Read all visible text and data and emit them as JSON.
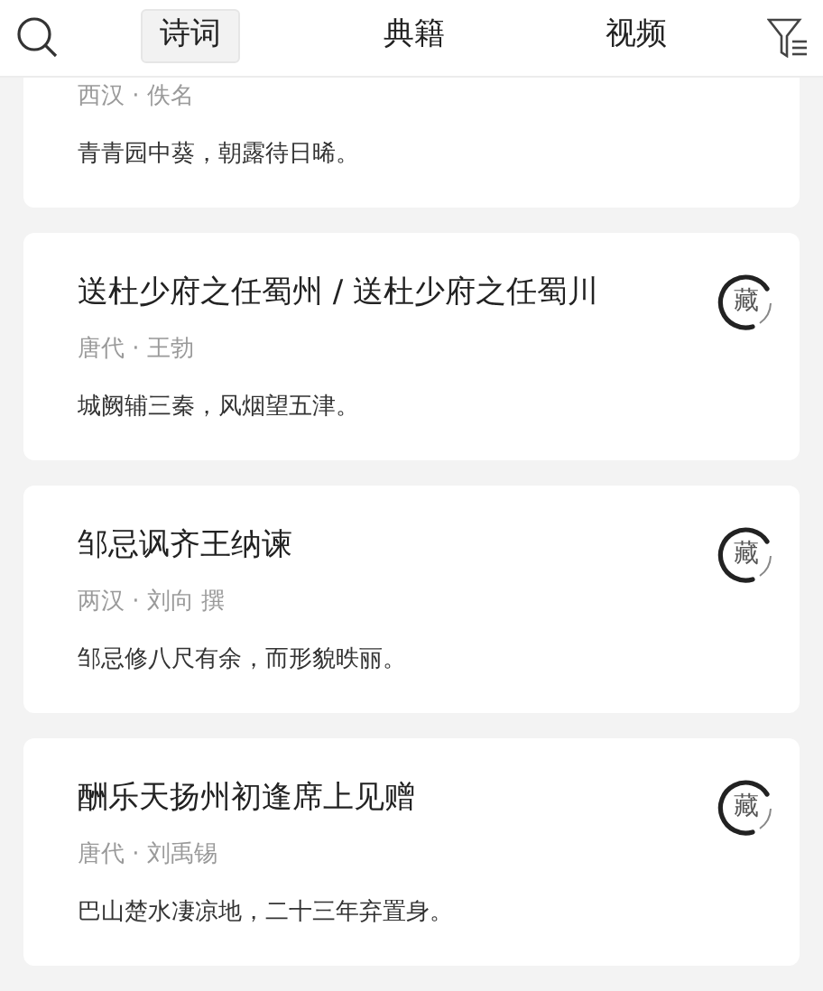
{
  "tabs": [
    {
      "label": "诗词",
      "selected": true
    },
    {
      "label": "典籍",
      "selected": false
    },
    {
      "label": "视频",
      "selected": false
    }
  ],
  "poems": [
    {
      "meta": "西汉 · 佚名",
      "line": "青青园中葵，朝露待日晞。"
    },
    {
      "title": "送杜少府之任蜀州 / 送杜少府之任蜀川",
      "meta": "唐代 · 王勃",
      "line": "城阙辅三秦，风烟望五津。",
      "collect": "藏"
    },
    {
      "title": "邹忌讽齐王纳谏",
      "meta": "两汉 · 刘向 撰",
      "line": "邹忌修八尺有余，而形貌昳丽。",
      "collect": "藏"
    },
    {
      "title": "酬乐天扬州初逢席上见赠",
      "meta": "唐代 · 刘禹锡",
      "line": "巴山楚水凄凉地，二十三年弃置身。",
      "collect": "藏"
    }
  ]
}
